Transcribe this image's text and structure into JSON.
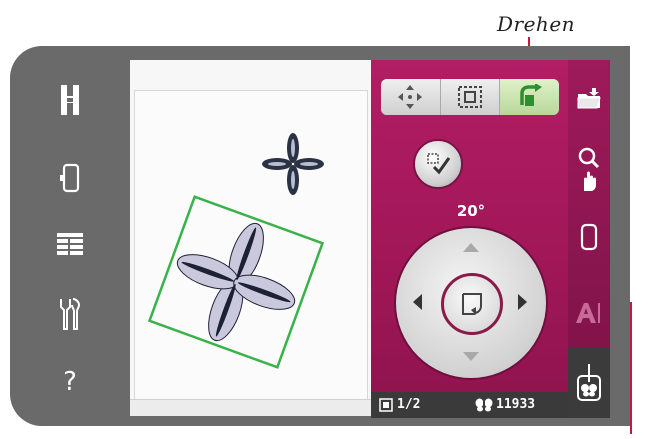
{
  "callout": {
    "label": "Drehen"
  },
  "sidebar": {
    "items": [
      {
        "name": "hoop-icon"
      },
      {
        "name": "fabric-icon"
      },
      {
        "name": "list-icon"
      },
      {
        "name": "tools-icon"
      },
      {
        "name": "help-icon",
        "label": "?"
      }
    ]
  },
  "edit_panel": {
    "angle": "20°",
    "tools": [
      "move",
      "resize",
      "rotate"
    ],
    "active_tool": "rotate"
  },
  "status_bar": {
    "pages": "1/2",
    "stitches": "11933"
  },
  "colors": {
    "panel": "#a8195d",
    "frame_outline": "#39b24a",
    "active_tool": "#3fa83a"
  }
}
